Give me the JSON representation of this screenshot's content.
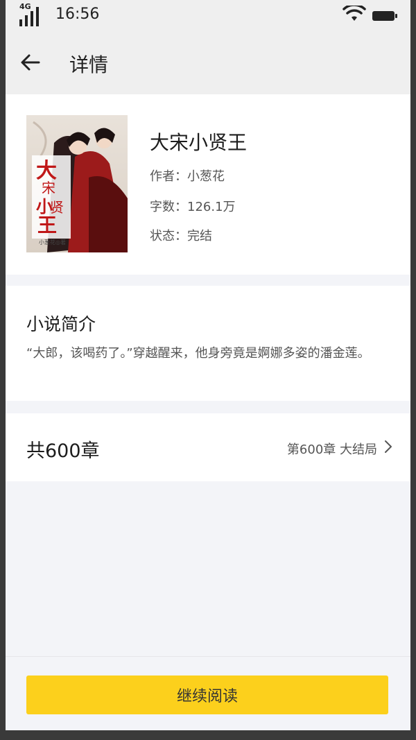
{
  "status_bar": {
    "network": "4G",
    "time": "16:56"
  },
  "header": {
    "title": "详情"
  },
  "book": {
    "title": "大宋小贤王",
    "author_line": "作者：小葱花",
    "words_line": "字数：126.1万",
    "status_line": "状态：完结",
    "cover_title_text": "大宋小贤王",
    "cover_author_text": "小葱花◎著"
  },
  "intro": {
    "heading": "小说简介",
    "text": "“大郎，该喝药了。”穿越醒来，他身旁竟是婀娜多姿的潘金莲。"
  },
  "chapters": {
    "count_label": "共600章",
    "latest_label": "第600章 大结局"
  },
  "actions": {
    "continue_label": "继续阅读"
  },
  "colors": {
    "accent": "#fcd01c",
    "header_bg": "#efefef",
    "page_bg": "#f3f4f8"
  },
  "icons": {
    "back": "arrow-left-icon",
    "chevron": "chevron-right-icon",
    "wifi": "wifi-icon",
    "battery": "battery-icon",
    "signal": "signal-icon"
  }
}
